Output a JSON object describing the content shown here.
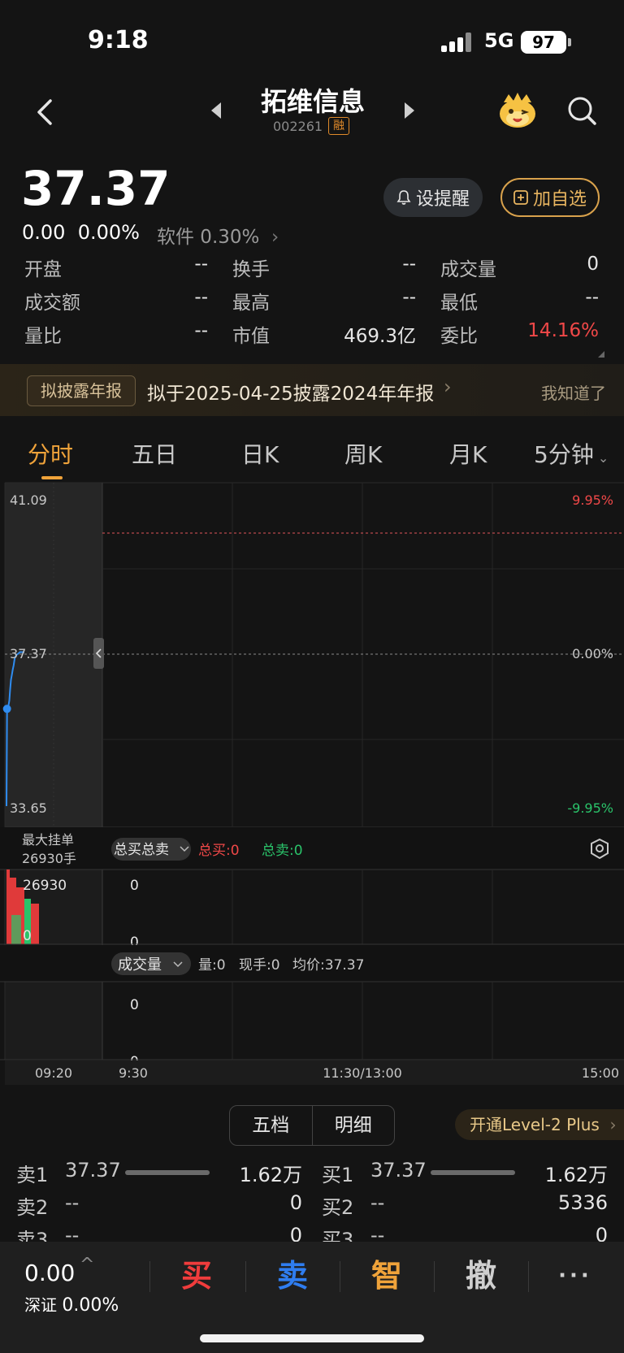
{
  "status": {
    "time": "9:18",
    "network": "5G",
    "battery": "97"
  },
  "header": {
    "name": "拓维信息",
    "code": "002261",
    "badge": "融"
  },
  "summary": {
    "price": "37.37",
    "change": "0.00",
    "change_pct": "0.00%",
    "sector": "软件 0.30%",
    "alert_label": "设提醒",
    "watch_label": "加自选"
  },
  "quote": [
    {
      "label": "开盘",
      "value": "--"
    },
    {
      "label": "换手",
      "value": "--"
    },
    {
      "label": "成交量",
      "value": "0"
    },
    {
      "label": "成交额",
      "value": "--"
    },
    {
      "label": "最高",
      "value": "--"
    },
    {
      "label": "最低",
      "value": "--"
    },
    {
      "label": "量比",
      "value": "--"
    },
    {
      "label": "市值",
      "value": "469.3亿"
    },
    {
      "label": "委比",
      "value": "14.16%"
    }
  ],
  "notice": {
    "tag": "拟披露年报",
    "text": "拟于2025-04-25披露2024年年报",
    "dismiss": "我知道了"
  },
  "tabs": [
    "分时",
    "五日",
    "日K",
    "周K",
    "月K",
    "5分钟"
  ],
  "chart_data": {
    "type": "line",
    "price_axis": {
      "top": "41.09",
      "mid": "37.37",
      "bottom": "33.65"
    },
    "pct_axis": {
      "top": "9.95%",
      "mid": "0.00%",
      "bottom": "-9.95%"
    },
    "ylim": [
      33.65,
      41.09
    ],
    "prev_close": 37.37,
    "auction_line": [
      [
        0,
        33.65
      ],
      [
        0.3,
        36.0
      ],
      [
        1,
        36.05
      ],
      [
        1.6,
        36.2
      ],
      [
        2,
        36.45
      ],
      [
        2.5,
        36.7
      ],
      [
        3,
        36.82
      ],
      [
        3.5,
        36.95
      ],
      [
        4,
        37.05
      ],
      [
        4.6,
        37.22
      ],
      [
        5.5,
        37.3
      ],
      [
        6.5,
        37.33
      ],
      [
        7.5,
        37.37
      ],
      [
        10,
        37.37
      ]
    ],
    "order_panel": {
      "max_order_label": "最大挂单",
      "max_order_value": "26930手",
      "selector": "总买总卖",
      "total_buy": "总买:0",
      "total_sell": "总卖:0",
      "left_max": "26930",
      "left_min": "0",
      "right_max": "0",
      "right_min": "0"
    },
    "volume_panel": {
      "selector": "成交量",
      "volume": "量:0",
      "current": "现手:0",
      "avg_price": "均价:37.37",
      "right_max": "0",
      "right_min": "0"
    },
    "time_axis": [
      "09:20",
      "9:30",
      "11:30/13:00",
      "15:00"
    ]
  },
  "depth": {
    "tab_five": "五档",
    "tab_detail": "明细",
    "level2": "开通Level-2 Plus",
    "sell": [
      {
        "label": "卖1",
        "price": "37.37",
        "vol": "1.62万"
      },
      {
        "label": "卖2",
        "price": "--",
        "vol": "0"
      },
      {
        "label": "卖3",
        "price": "--",
        "vol": "0"
      }
    ],
    "buy": [
      {
        "label": "买1",
        "price": "37.37",
        "vol": "1.62万"
      },
      {
        "label": "买2",
        "price": "--",
        "vol": "5336"
      },
      {
        "label": "买3",
        "price": "--",
        "vol": "0"
      }
    ]
  },
  "bottom": {
    "index_value": "0.00",
    "index_name": "深证",
    "index_pct": "0.00%",
    "buy": "买",
    "sell": "卖",
    "smart": "智",
    "cancel": "撤",
    "more": "···"
  },
  "colors": {
    "up": "#f04848",
    "down": "#2ac36a",
    "accent": "#f0a33a",
    "line": "#2f8cf0"
  }
}
